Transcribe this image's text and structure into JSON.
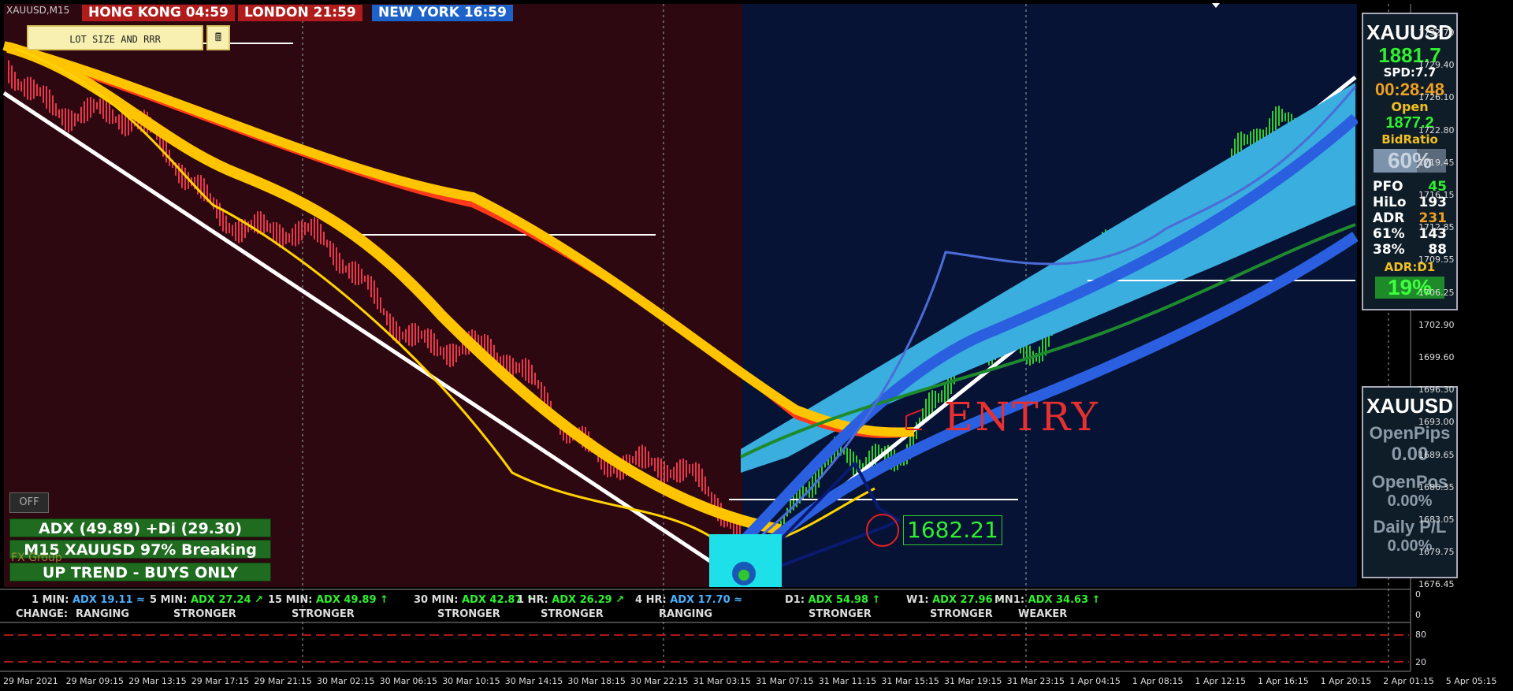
{
  "symbol_tag": "XAUUSD,M15",
  "clocks": [
    {
      "label": "HONG KONG 04:59",
      "bg": "#b01c1c"
    },
    {
      "label": "LONDON 21:59",
      "bg": "#b01c1c"
    },
    {
      "label": "NEW YORK 16:59",
      "bg": "#1c62c8"
    }
  ],
  "lot_button": "LOT SIZE AND RRR",
  "lot_icon": "calculator-icon",
  "off_button": "OFF",
  "banners": [
    "ADX (49.89)   +Di (29.30)",
    "M15 XAUUSD 97% Breaking",
    "UP TREND - BUYS ONLY"
  ],
  "watermark": "FX Group",
  "annotations": {
    "entry": "ENTRY",
    "price_tag": "1682.21"
  },
  "panel1": {
    "symbol": "XAUUSD",
    "price": "1881.7",
    "spread": "SPD:7.7",
    "timer": "00:28:48",
    "open_label": "Open",
    "open_value": "1877.2",
    "bid_ratio_label": "BidRatio",
    "bid_ratio": "60%",
    "bid_fill": 0.6,
    "stats": [
      {
        "k": "PFO",
        "v": "45",
        "color": "#2ef02e"
      },
      {
        "k": "HiLo",
        "v": "193",
        "color": "#ffffff"
      },
      {
        "k": "ADR",
        "v": "231",
        "color": "#f0a020"
      },
      {
        "k": "61%",
        "v": "143",
        "color": "#ffffff"
      },
      {
        "k": "38%",
        "v": "88",
        "color": "#ffffff"
      }
    ],
    "adr_label": "ADR:D1",
    "adr_value": "19%"
  },
  "panel2": {
    "symbol": "XAUUSD",
    "open_pips_label": "OpenPips",
    "open_pips": "0.00",
    "open_pos_label": "OpenPos",
    "open_pos": "0.00%",
    "daily_pl_label": "Daily P/L",
    "daily_pl": "0.00%"
  },
  "adx_strip": {
    "items": [
      {
        "tf": "1 MIN:",
        "adx": "ADX 19.11",
        "arrow": "≈",
        "color": "#4ab0ff",
        "change": "RANGING"
      },
      {
        "tf": "5 MIN:",
        "adx": "ADX 27.24",
        "arrow": "↗",
        "color": "#2ef02e",
        "change": "STRONGER"
      },
      {
        "tf": "15 MIN:",
        "adx": "ADX 49.89",
        "arrow": "↑",
        "color": "#2ef02e",
        "change": "STRONGER"
      },
      {
        "tf": "30 MIN:",
        "adx": "ADX 42.87",
        "arrow": "↑",
        "color": "#2ef02e",
        "change": "STRONGER"
      },
      {
        "tf": "1 HR:",
        "adx": "ADX 26.29",
        "arrow": "↗",
        "color": "#2ef02e",
        "change": "STRONGER"
      },
      {
        "tf": "4 HR:",
        "adx": "ADX 17.70",
        "arrow": "≈",
        "color": "#4ab0ff",
        "change": "RANGING"
      },
      {
        "tf": "D1:",
        "adx": "ADX 54.98",
        "arrow": "↑",
        "color": "#2ef02e",
        "change": "STRONGER"
      },
      {
        "tf": "W1:",
        "adx": "ADX 27.96",
        "arrow": "↗",
        "color": "#2ef02e",
        "change": "STRONGER"
      },
      {
        "tf": "MN1:",
        "adx": "ADX 34.63",
        "arrow": "↑",
        "color": "#2ef02e",
        "change": "WEAKER"
      }
    ],
    "change_label": "CHANGE:"
  },
  "price_axis": [
    "1732.70",
    "1729.40",
    "1726.10",
    "1722.80",
    "1719.45",
    "1716.15",
    "1712.85",
    "1709.55",
    "1706.25",
    "1702.90",
    "1699.60",
    "1696.30",
    "1693.00",
    "1689.65",
    "1686.35",
    "1683.05",
    "1679.75",
    "1676.45"
  ],
  "sub_axis": [
    "0",
    "0"
  ],
  "sub2_axis": [
    "80",
    "20"
  ],
  "time_axis": [
    "29 Mar 2021",
    "29 Mar 09:15",
    "29 Mar 13:15",
    "29 Mar 17:15",
    "29 Mar 21:15",
    "30 Mar 02:15",
    "30 Mar 06:15",
    "30 Mar 10:15",
    "30 Mar 14:15",
    "30 Mar 18:15",
    "30 Mar 22:15",
    "31 Mar 03:15",
    "31 Mar 07:15",
    "31 Mar 11:15",
    "31 Mar 15:15",
    "31 Mar 19:15",
    "31 Mar 23:15",
    "1 Apr 04:15",
    "1 Apr 08:15",
    "1 Apr 12:15",
    "1 Apr 16:15",
    "1 Apr 20:15",
    "2 Apr 01:15",
    "5 Apr 05:15"
  ],
  "colors": {
    "bear_bg": "#2e0810",
    "bull_bg": "#071334",
    "up_candle": "#2ed02e",
    "down_candle": "#e8364a"
  }
}
